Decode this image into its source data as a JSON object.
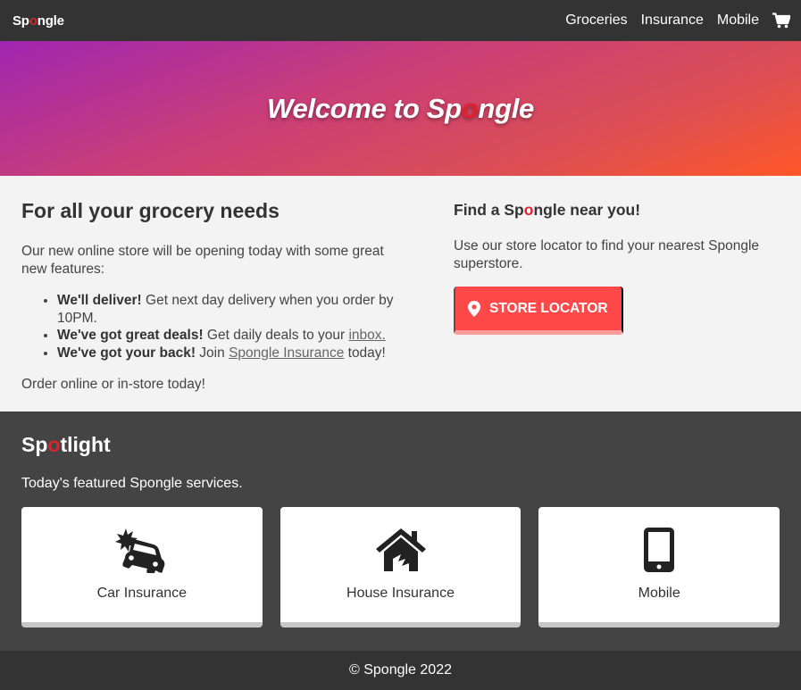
{
  "nav": {
    "brand_pre": "Sp",
    "brand_o": "o",
    "brand_post": "ngle",
    "links": [
      "Groceries",
      "Insurance",
      "Mobile"
    ],
    "cart_icon": "shopping-cart-icon"
  },
  "hero": {
    "title_pre": "Welcome to Sp",
    "title_o": "o",
    "title_post": "ngle"
  },
  "left": {
    "heading": "For all your grocery needs",
    "intro": "Our new online store will be opening today with some great new features:",
    "features": [
      {
        "bold": "We'll deliver!",
        "text": " Get next day delivery when you order by 10PM.",
        "link": "",
        "after": ""
      },
      {
        "bold": "We've got great deals!",
        "text": " Get daily deals to your ",
        "link": "inbox.",
        "after": ""
      },
      {
        "bold": "We've got your back!",
        "text": " Join ",
        "link": "Spongle Insurance",
        "after": " today!"
      }
    ],
    "outro": "Order online or in-store today!"
  },
  "right": {
    "heading_pre": "Find a Sp",
    "heading_o": "o",
    "heading_post": "ngle near you!",
    "text": "Use our store locator to find your nearest Spongle superstore.",
    "button_label": "STORE LOCATOR",
    "button_icon": "map-pin-icon"
  },
  "spotlight": {
    "title_pre": "Sp",
    "title_o": "o",
    "title_post": "tlight",
    "subtitle": "Today's featured Spongle services.",
    "cards": [
      {
        "label": "Car Insurance",
        "icon": "car-crash-icon"
      },
      {
        "label": "House Insurance",
        "icon": "house-damage-icon"
      },
      {
        "label": "Mobile",
        "icon": "mobile-phone-icon"
      }
    ]
  },
  "footer": {
    "text": "© Spongle 2022"
  },
  "colors": {
    "accent": "#ff4848",
    "brand_red": "#e0212e",
    "nav_bg": "#333333",
    "spotlight_bg": "#444444"
  }
}
